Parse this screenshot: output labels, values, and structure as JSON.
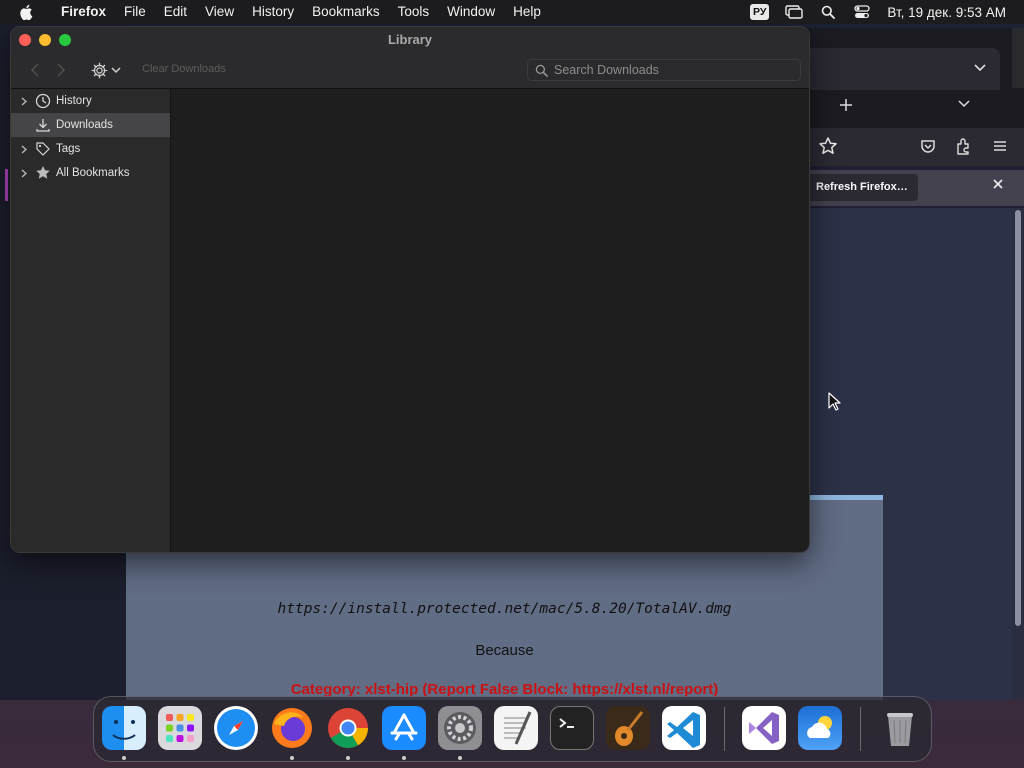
{
  "menubar": {
    "app_name": "Firefox",
    "items": [
      "File",
      "Edit",
      "View",
      "History",
      "Bookmarks",
      "Tools",
      "Window",
      "Help"
    ],
    "input_source": "РУ",
    "clock": "Вт, 19 дек.  9:53 AM"
  },
  "library": {
    "title": "Library",
    "clear_downloads": "Clear Downloads",
    "search_placeholder": "Search Downloads",
    "sidebar": [
      {
        "label": "History",
        "icon": "clock-icon",
        "expandable": true,
        "selected": false
      },
      {
        "label": "Downloads",
        "icon": "download-icon",
        "expandable": false,
        "selected": true
      },
      {
        "label": "Tags",
        "icon": "tag-icon",
        "expandable": true,
        "selected": false
      },
      {
        "label": "All Bookmarks",
        "icon": "star-icon",
        "expandable": true,
        "selected": false
      }
    ]
  },
  "browser": {
    "notice_button": "Refresh Firefox…",
    "page": {
      "url": "https://install.protected.net/mac/5.8.20/TotalAV.dmg",
      "because": "Because",
      "category": "Category: xlst-hip (Report False Block: https://xlst.nl/report)"
    }
  },
  "dock": {
    "apps": [
      {
        "name": "finder",
        "running": true
      },
      {
        "name": "launchpad",
        "running": false
      },
      {
        "name": "safari",
        "running": false
      },
      {
        "name": "firefox",
        "running": true
      },
      {
        "name": "chrome",
        "running": true
      },
      {
        "name": "app-store",
        "running": true
      },
      {
        "name": "system-settings",
        "running": true
      },
      {
        "name": "textedit",
        "running": false
      },
      {
        "name": "terminal",
        "running": false
      },
      {
        "name": "garageband",
        "running": false
      },
      {
        "name": "vscode",
        "running": false
      },
      {
        "name": "visual-studio",
        "running": false
      },
      {
        "name": "weather",
        "running": false
      },
      {
        "name": "trash",
        "running": false
      }
    ]
  },
  "colors": {
    "selected_row": "#454547",
    "traffic_close": "#ff5f57",
    "traffic_min": "#febc2e",
    "traffic_max": "#28c840",
    "category_red": "#cc1111"
  }
}
